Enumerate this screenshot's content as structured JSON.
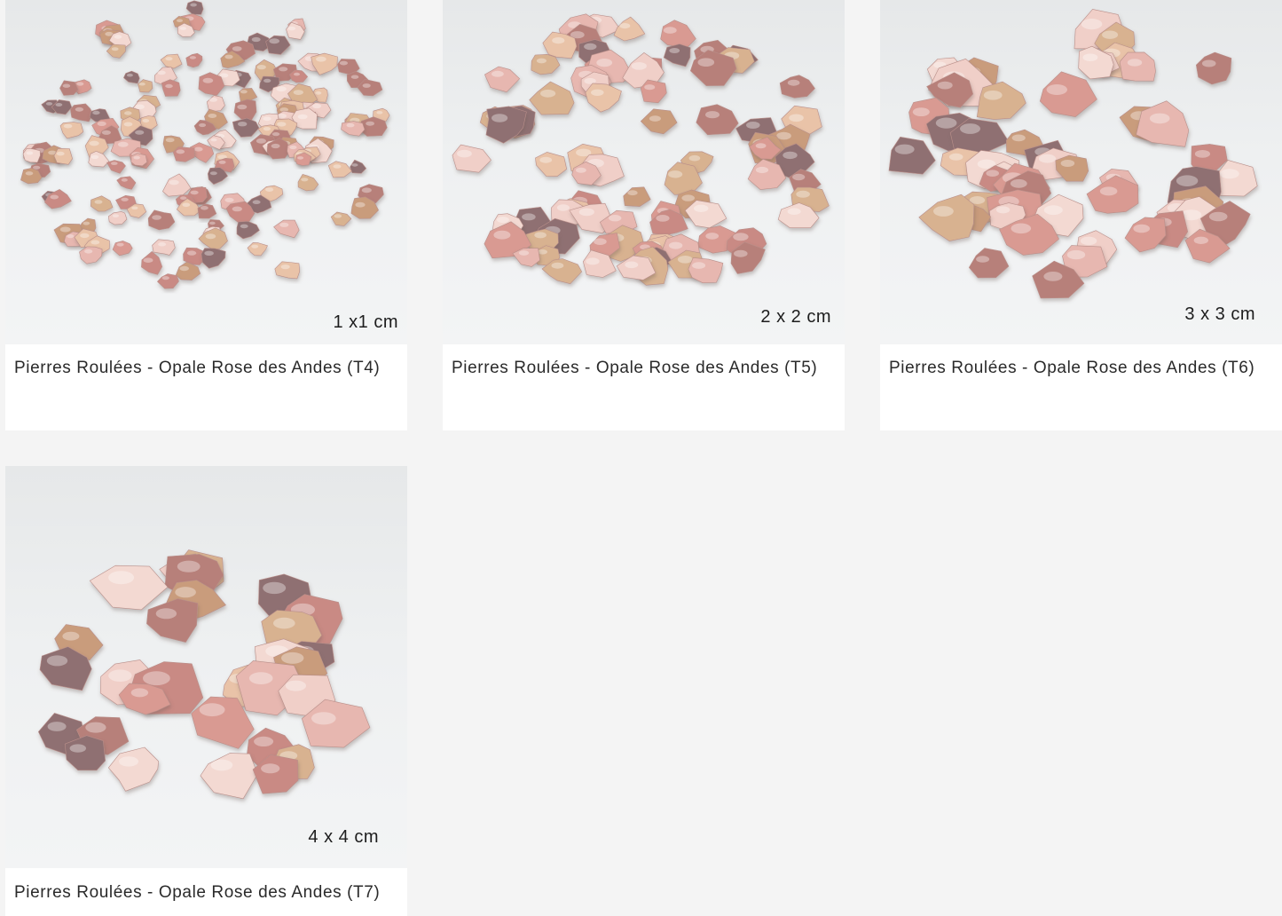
{
  "products": [
    {
      "title": "Pierres Roulées - Opale Rose des Andes (T4)",
      "size_label": "1 x1 cm"
    },
    {
      "title": "Pierres Roulées - Opale Rose des Andes (T5)",
      "size_label": "2 x 2 cm"
    },
    {
      "title": "Pierres Roulées - Opale Rose des Andes (T6)",
      "size_label": "3 x 3 cm"
    },
    {
      "title": "Pierres Roulées - Opale Rose des Andes (T7)",
      "size_label": "4 x 4 cm"
    }
  ],
  "colors": {
    "page_background": "#f4f4f4",
    "card_background": "#ffffff",
    "stone_palette": [
      "#e7b7b0",
      "#d99a92",
      "#f0cfc8",
      "#c98a84",
      "#b7807a",
      "#e9c3a8",
      "#d8b290",
      "#8f6f72",
      "#f3d9d2",
      "#c99c7c"
    ]
  }
}
